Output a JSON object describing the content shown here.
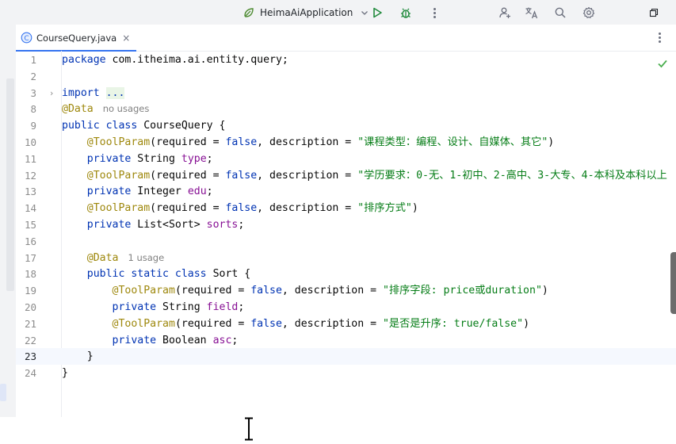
{
  "titlebar": {
    "run_config": "HeimaAiApplication",
    "icons": [
      "app-icon",
      "chevron-down-icon",
      "run-icon",
      "debug-icon",
      "more-icon",
      "add-user-icon",
      "translate-icon",
      "search-icon",
      "gear-icon",
      "restore-window-icon"
    ]
  },
  "tab": {
    "icon_letter": "C",
    "label": "CourseQuery.java",
    "close": "×"
  },
  "colors": {
    "keyword": "#0033b3",
    "annotation": "#9e880d",
    "string": "#067d17",
    "field": "#871094",
    "accent": "#3574f0",
    "check": "#4caf50"
  },
  "editor": {
    "lines": [
      {
        "num": "1",
        "tokens": [
          {
            "t": "package",
            "c": "kw"
          },
          {
            "t": " com.itheima.ai.entity.query;",
            "c": ""
          }
        ]
      },
      {
        "num": "2",
        "tokens": []
      },
      {
        "num": "3",
        "fold": true,
        "tokens": [
          {
            "t": "import",
            "c": "kw"
          },
          {
            "t": " ",
            "c": ""
          },
          {
            "t": "...",
            "c": "folded"
          }
        ]
      },
      {
        "num": "8",
        "tokens": [
          {
            "t": "@Data",
            "c": "ann"
          }
        ],
        "hint": "no usages"
      },
      {
        "num": "9",
        "tokens": [
          {
            "t": "public class",
            "c": "kw"
          },
          {
            "t": " CourseQuery {",
            "c": ""
          }
        ]
      },
      {
        "num": "10",
        "tokens": [
          {
            "t": "    ",
            "c": ""
          },
          {
            "t": "@ToolParam",
            "c": "ann"
          },
          {
            "t": "(required = ",
            "c": ""
          },
          {
            "t": "false",
            "c": "kw"
          },
          {
            "t": ", description = ",
            "c": ""
          },
          {
            "t": "\"课程类型：编程、设计、自媒体、其它\"",
            "c": "str"
          },
          {
            "t": ")",
            "c": ""
          }
        ]
      },
      {
        "num": "11",
        "tokens": [
          {
            "t": "    ",
            "c": ""
          },
          {
            "t": "private",
            "c": "kw"
          },
          {
            "t": " String ",
            "c": ""
          },
          {
            "t": "type",
            "c": "fld"
          },
          {
            "t": ";",
            "c": ""
          }
        ]
      },
      {
        "num": "12",
        "tokens": [
          {
            "t": "    ",
            "c": ""
          },
          {
            "t": "@ToolParam",
            "c": "ann"
          },
          {
            "t": "(required = ",
            "c": ""
          },
          {
            "t": "false",
            "c": "kw"
          },
          {
            "t": ", description = ",
            "c": ""
          },
          {
            "t": "\"学历要求：0-无、1-初中、2-高中、3-大专、4-本科及本科以上",
            "c": "str"
          }
        ]
      },
      {
        "num": "13",
        "tokens": [
          {
            "t": "    ",
            "c": ""
          },
          {
            "t": "private",
            "c": "kw"
          },
          {
            "t": " Integer ",
            "c": ""
          },
          {
            "t": "edu",
            "c": "fld"
          },
          {
            "t": ";",
            "c": ""
          }
        ]
      },
      {
        "num": "14",
        "tokens": [
          {
            "t": "    ",
            "c": ""
          },
          {
            "t": "@ToolParam",
            "c": "ann"
          },
          {
            "t": "(required = ",
            "c": ""
          },
          {
            "t": "false",
            "c": "kw"
          },
          {
            "t": ", description = ",
            "c": ""
          },
          {
            "t": "\"排序方式\"",
            "c": "str"
          },
          {
            "t": ")",
            "c": ""
          }
        ]
      },
      {
        "num": "15",
        "tokens": [
          {
            "t": "    ",
            "c": ""
          },
          {
            "t": "private",
            "c": "kw"
          },
          {
            "t": " List<Sort> ",
            "c": ""
          },
          {
            "t": "sorts",
            "c": "fld"
          },
          {
            "t": ";",
            "c": ""
          }
        ]
      },
      {
        "num": "16",
        "tokens": []
      },
      {
        "num": "17",
        "tokens": [
          {
            "t": "    ",
            "c": ""
          },
          {
            "t": "@Data",
            "c": "ann"
          }
        ],
        "hint": "1 usage"
      },
      {
        "num": "18",
        "tokens": [
          {
            "t": "    ",
            "c": ""
          },
          {
            "t": "public static class",
            "c": "kw"
          },
          {
            "t": " Sort {",
            "c": ""
          }
        ]
      },
      {
        "num": "19",
        "tokens": [
          {
            "t": "        ",
            "c": ""
          },
          {
            "t": "@ToolParam",
            "c": "ann"
          },
          {
            "t": "(required = ",
            "c": ""
          },
          {
            "t": "false",
            "c": "kw"
          },
          {
            "t": ", description = ",
            "c": ""
          },
          {
            "t": "\"排序字段: price或duration\"",
            "c": "str"
          },
          {
            "t": ")",
            "c": ""
          }
        ]
      },
      {
        "num": "20",
        "tokens": [
          {
            "t": "        ",
            "c": ""
          },
          {
            "t": "private",
            "c": "kw"
          },
          {
            "t": " String ",
            "c": ""
          },
          {
            "t": "field",
            "c": "fld"
          },
          {
            "t": ";",
            "c": ""
          }
        ]
      },
      {
        "num": "21",
        "tokens": [
          {
            "t": "        ",
            "c": ""
          },
          {
            "t": "@ToolParam",
            "c": "ann"
          },
          {
            "t": "(required = ",
            "c": ""
          },
          {
            "t": "false",
            "c": "kw"
          },
          {
            "t": ", description = ",
            "c": ""
          },
          {
            "t": "\"是否是升序: true/false\"",
            "c": "str"
          },
          {
            "t": ")",
            "c": ""
          }
        ]
      },
      {
        "num": "22",
        "tokens": [
          {
            "t": "        ",
            "c": ""
          },
          {
            "t": "private",
            "c": "kw"
          },
          {
            "t": " Boolean ",
            "c": ""
          },
          {
            "t": "asc",
            "c": "fld"
          },
          {
            "t": ";",
            "c": ""
          }
        ]
      },
      {
        "num": "23",
        "current": true,
        "tokens": [
          {
            "t": "    }",
            "c": ""
          }
        ]
      },
      {
        "num": "24",
        "tokens": [
          {
            "t": "}",
            "c": ""
          }
        ]
      }
    ]
  }
}
